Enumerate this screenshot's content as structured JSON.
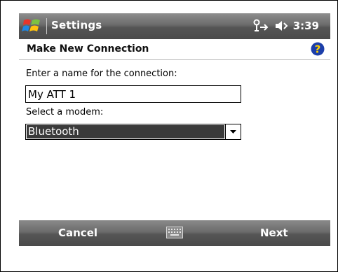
{
  "titlebar": {
    "app_title": "Settings",
    "clock": "3:39"
  },
  "header": {
    "page_title": "Make New Connection"
  },
  "form": {
    "name_label": "Enter a name for the connection:",
    "name_value": "My ATT 1",
    "modem_label": "Select a modem:",
    "modem_value": "Bluetooth"
  },
  "softkeys": {
    "left": "Cancel",
    "right": "Next"
  },
  "colors": {
    "bar_dark": "#4a4a4a",
    "selection": "#3a3a3a",
    "help_blue": "#1c3faa",
    "help_yellow": "#ffd200"
  },
  "icons": [
    "windows-start-icon",
    "connectivity-icon",
    "volume-icon",
    "help-icon",
    "dropdown-arrow-icon",
    "keyboard-icon"
  ]
}
